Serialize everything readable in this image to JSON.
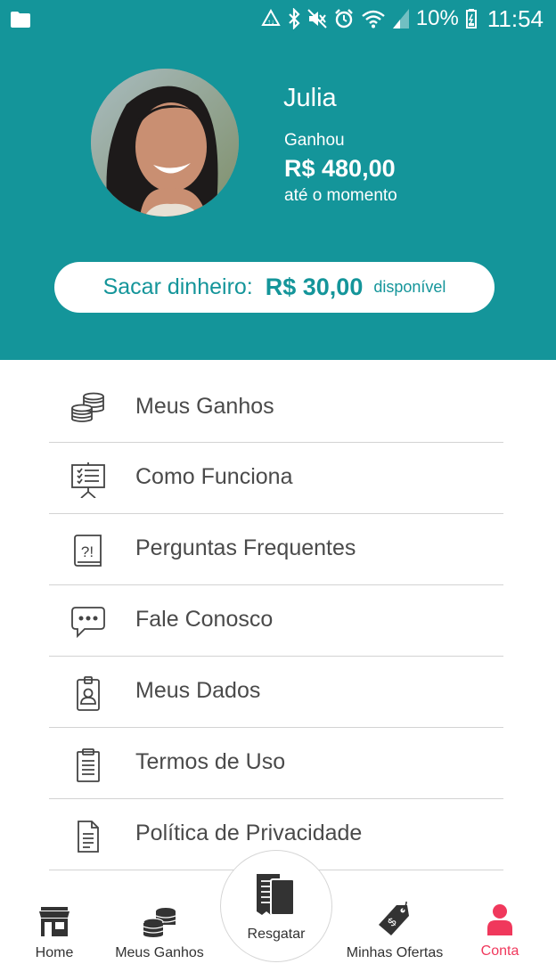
{
  "status_bar": {
    "battery_pct": "10%",
    "time": "11:54",
    "icons": [
      "folder-icon",
      "data-saver-icon",
      "bluetooth-icon",
      "mute-icon",
      "alarm-icon",
      "wifi-icon",
      "signal-icon",
      "battery-icon"
    ]
  },
  "profile": {
    "name": "Julia",
    "earned_label": "Ganhou",
    "earned_amount": "R$ 480,00",
    "earned_sub": "até o momento"
  },
  "withdraw": {
    "label": "Sacar dinheiro:",
    "amount": "R$ 30,00",
    "suffix": "disponível"
  },
  "menu": {
    "items": [
      {
        "label": "Meus Ganhos",
        "icon": "coins-icon"
      },
      {
        "label": "Como Funciona",
        "icon": "presentation-board-icon"
      },
      {
        "label": "Perguntas Frequentes",
        "icon": "faq-book-icon"
      },
      {
        "label": "Fale Conosco",
        "icon": "chat-bubble-icon"
      },
      {
        "label": "Meus Dados",
        "icon": "id-badge-icon"
      },
      {
        "label": "Termos de Uso",
        "icon": "clipboard-icon"
      },
      {
        "label": "Política de Privacidade",
        "icon": "document-icon"
      }
    ]
  },
  "bottom_nav": {
    "home": "Home",
    "earnings": "Meus Ganhos",
    "redeem": "Resgatar",
    "offers": "Minhas Ofertas",
    "account": "Conta",
    "active": "Conta"
  },
  "colors": {
    "header_bg": "#14959a",
    "accent": "#14959a",
    "active_nav": "#f0385c",
    "nav_icon": "#333333"
  }
}
